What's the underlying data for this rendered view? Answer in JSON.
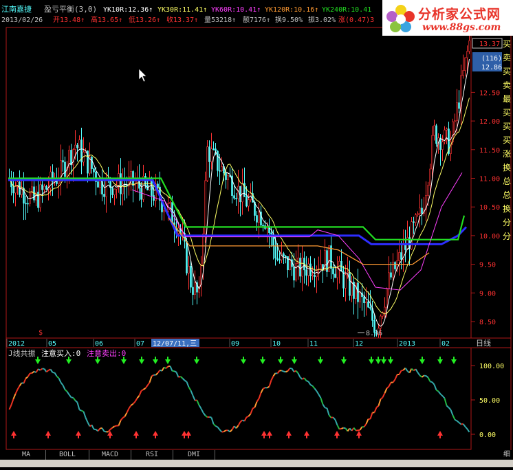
{
  "header": {
    "stock_name": "江南嘉捷",
    "indicator": "盈亏平衡(3,0)",
    "yk10r": "YK10R:12.36↑",
    "yk30r": "YK30R:11.41↑",
    "yk60r": "YK60R:10.41↑",
    "yk120r": "YK120R:10.16↑",
    "yk240r": "YK240R:10.41",
    "date": "2013/02/26",
    "open": "开13.48↑",
    "high": "高13.65↑",
    "low": "低13.26↑",
    "close": "收13.37↑",
    "volume": "量53218↑",
    "amount": "额7176↑",
    "turnover": "换9.50%",
    "amplitude": "振3.02%",
    "change": "涨(0.47)3"
  },
  "logo": {
    "title": "分析家公式网",
    "url": "www.88gs.com"
  },
  "right_panel": {
    "price_box_top": "13.37",
    "price_box_count": "(116)",
    "price_box_bottom": "12.86",
    "side_chars": [
      "买",
      "卖",
      "买",
      "卖",
      "最",
      "买",
      "买",
      "买",
      "涨",
      "换",
      "总",
      "总",
      "换",
      "分",
      "分"
    ]
  },
  "price_axis": [
    "12.50",
    "12.00",
    "11.50",
    "11.00",
    "10.50",
    "10.00",
    "9.50",
    "9.00",
    "8.50"
  ],
  "low_annotation": "8.36",
  "time_axis": [
    "2012",
    "05",
    "06",
    "07",
    "12/07/11,三",
    "09",
    "10",
    "11",
    "12",
    "2013",
    "02"
  ],
  "time_axis_right": "日线",
  "sub_title": {
    "name": "J线共振",
    "buy": "注意买入:0",
    "sell": "注意卖出:0"
  },
  "sub_axis": [
    "100.00",
    "50.00",
    "0.00"
  ],
  "tabs": [
    "MA",
    "BOLL",
    "MACD",
    "RSI",
    "DMI"
  ],
  "bottom_right": "细",
  "colors": {
    "up": "#ff3232",
    "down": "#54fcfc",
    "green": "#22dd22",
    "blue": "#2d2dff",
    "white": "#ffffff",
    "yellow": "#ffff66",
    "magenta": "#ff40ff",
    "orange": "#ff9a33"
  }
}
